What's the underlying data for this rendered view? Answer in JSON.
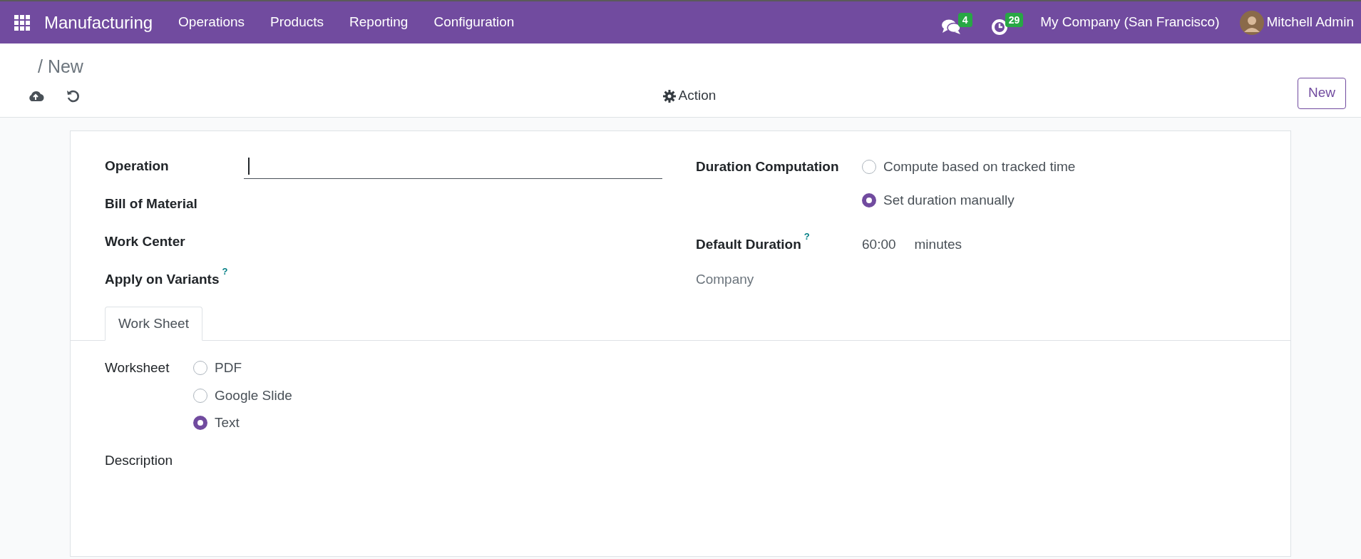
{
  "navbar": {
    "app_name": "Manufacturing",
    "menu": [
      "Operations",
      "Products",
      "Reporting",
      "Configuration"
    ],
    "messages_count": "4",
    "activities_count": "29",
    "company": "My Company (San Francisco)",
    "user": "Mitchell Admin"
  },
  "breadcrumb": "/ New",
  "toolbar": {
    "action": "Action",
    "new_button": "New"
  },
  "form": {
    "left_fields": [
      {
        "label": "Operation",
        "kind": "input"
      },
      {
        "label": "Bill of Material",
        "kind": "plain"
      },
      {
        "label": "Work Center",
        "kind": "plain"
      },
      {
        "label": "Apply on Variants",
        "kind": "plain",
        "help": "?"
      }
    ],
    "duration_computation": {
      "label": "Duration Computation",
      "options": [
        {
          "label": "Compute based on tracked time",
          "selected": false
        },
        {
          "label": "Set duration manually",
          "selected": true
        }
      ]
    },
    "default_duration": {
      "label": "Default Duration",
      "help": "?",
      "value": "60:00",
      "unit": "minutes"
    },
    "company_label": "Company",
    "tabs": [
      {
        "label": "Work Sheet",
        "selected": true
      }
    ],
    "worksheet": {
      "label": "Worksheet",
      "options": [
        {
          "label": "PDF",
          "selected": false
        },
        {
          "label": "Google Slide",
          "selected": false
        },
        {
          "label": "Text",
          "selected": true
        }
      ]
    },
    "description_label": "Description"
  }
}
